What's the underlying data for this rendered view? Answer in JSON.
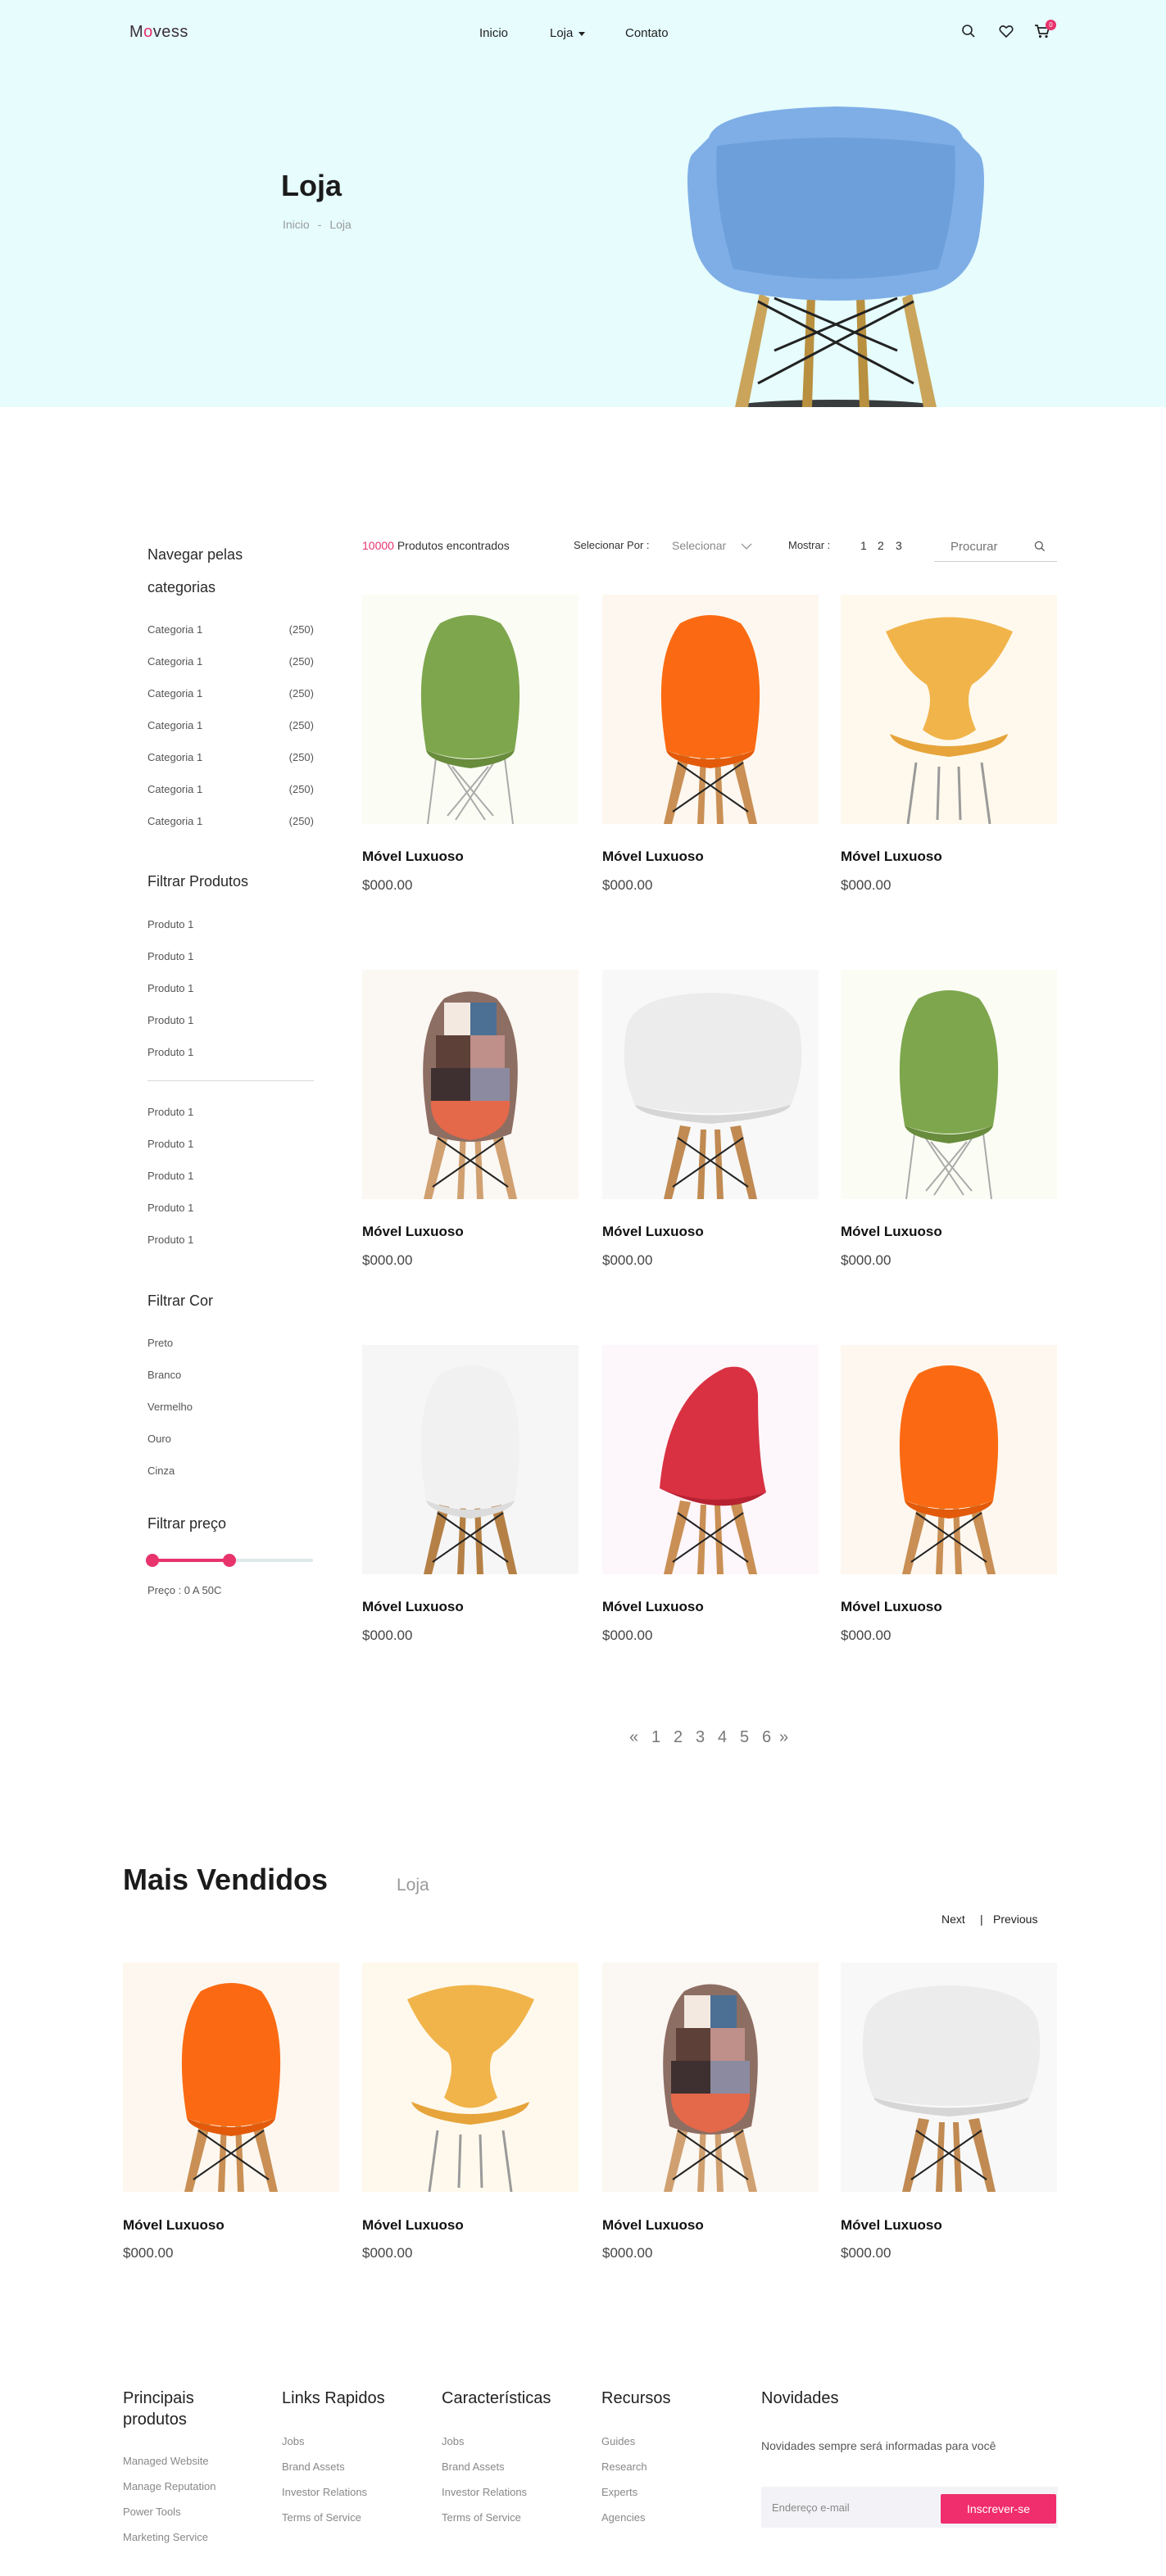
{
  "header": {
    "logo_prefix": "M",
    "logo_mark": "o",
    "logo_suffix": "vess",
    "nav": [
      "Inicio",
      "Loja",
      "Contato"
    ],
    "cart_count": "0",
    "icons": [
      "search-icon",
      "heart-icon",
      "cart-icon"
    ]
  },
  "hero": {
    "title": "Loja",
    "breadcrumb": [
      "Inicio",
      "Loja"
    ]
  },
  "sidebar": {
    "categories_title": "Navegar pelas categorias",
    "categories": [
      {
        "label": "Categoria 1",
        "count": "(250)"
      },
      {
        "label": "Categoria 1",
        "count": "(250)"
      },
      {
        "label": "Categoria 1",
        "count": "(250)"
      },
      {
        "label": "Categoria 1",
        "count": "(250)"
      },
      {
        "label": "Categoria 1",
        "count": "(250)"
      },
      {
        "label": "Categoria 1",
        "count": "(250)"
      },
      {
        "label": "Categoria 1",
        "count": "(250)"
      }
    ],
    "filter_products_title": "Filtrar Produtos",
    "products_a": [
      "Produto 1",
      "Produto 1",
      "Produto 1",
      "Produto 1",
      "Produto 1"
    ],
    "products_b": [
      "Produto 1",
      "Produto 1",
      "Produto 1",
      "Produto 1",
      "Produto 1"
    ],
    "filter_color_title": "Filtrar Cor",
    "colors": [
      "Preto",
      "Branco",
      "Vermelho",
      "Ouro",
      "Cinza"
    ],
    "filter_price_title": "Filtrar preço",
    "price_label": "Preço :  0   A  50C",
    "price_range_fraction": [
      0.0,
      0.48
    ]
  },
  "toolbar": {
    "count": "10000",
    "count_suffix": " Produtos encontrados",
    "sort_label": "Selecionar Por :",
    "sort_value": "Selecionar",
    "show_label": "Mostrar :",
    "show_options": [
      "1",
      "2",
      "3"
    ],
    "search_placeholder": "Procurar"
  },
  "products": [
    {
      "name": "Móvel Luxuoso",
      "price": "$000.00",
      "image": "green-shell-chair"
    },
    {
      "name": "Móvel Luxuoso",
      "price": "$000.00",
      "image": "orange-shell-chair"
    },
    {
      "name": "Móvel Luxuoso",
      "price": "$000.00",
      "image": "yellow-ant-chair"
    },
    {
      "name": "Móvel Luxuoso",
      "price": "$000.00",
      "image": "patchwork-chair"
    },
    {
      "name": "Móvel Luxuoso",
      "price": "$000.00",
      "image": "white-armchair"
    },
    {
      "name": "Móvel Luxuoso",
      "price": "$000.00",
      "image": "green-shell-chair"
    },
    {
      "name": "Móvel Luxuoso",
      "price": "$000.00",
      "image": "white-shell-chair"
    },
    {
      "name": "Móvel Luxuoso",
      "price": "$000.00",
      "image": "red-shell-chair"
    },
    {
      "name": "Móvel Luxuoso",
      "price": "$000.00",
      "image": "orange-shell-chair"
    }
  ],
  "pagination": {
    "prev": "«",
    "pages": [
      "1",
      "2",
      "3",
      "4",
      "5",
      "6"
    ],
    "next": "»"
  },
  "bestsellers": {
    "title": "Mais Vendidos",
    "subtitle": "Loja",
    "next_label": "Next",
    "separator": "|",
    "prev_label": "Previous",
    "items": [
      {
        "name": "Móvel Luxuoso",
        "price": "$000.00",
        "image": "orange-shell-chair"
      },
      {
        "name": "Móvel Luxuoso",
        "price": "$000.00",
        "image": "yellow-ant-chair"
      },
      {
        "name": "Móvel Luxuoso",
        "price": "$000.00",
        "image": "patchwork-chair"
      },
      {
        "name": "Móvel Luxuoso",
        "price": "$000.00",
        "image": "white-armchair"
      }
    ]
  },
  "footer": {
    "columns": [
      {
        "title": "Principais produtos",
        "links": [
          "Managed Website",
          "Manage Reputation",
          "Power Tools",
          "Marketing Service"
        ]
      },
      {
        "title": "Links Rapidos",
        "links": [
          "Jobs",
          "Brand Assets",
          "Investor Relations",
          "Terms of Service"
        ]
      },
      {
        "title": "Características",
        "links": [
          "Jobs",
          "Brand Assets",
          "Investor Relations",
          "Terms of Service"
        ]
      },
      {
        "title": "Recursos",
        "links": [
          "Guides",
          "Research",
          "Experts",
          "Agencies"
        ]
      }
    ],
    "newsletter_title": "Novidades",
    "newsletter_text": "Novidades sempre será informadas para você",
    "email_placeholder": "Endereço e-mail",
    "subscribe_label": "Inscrever-se"
  },
  "colors": {
    "accent": "#e8336d",
    "hero_bg": "#e6fcfd"
  }
}
